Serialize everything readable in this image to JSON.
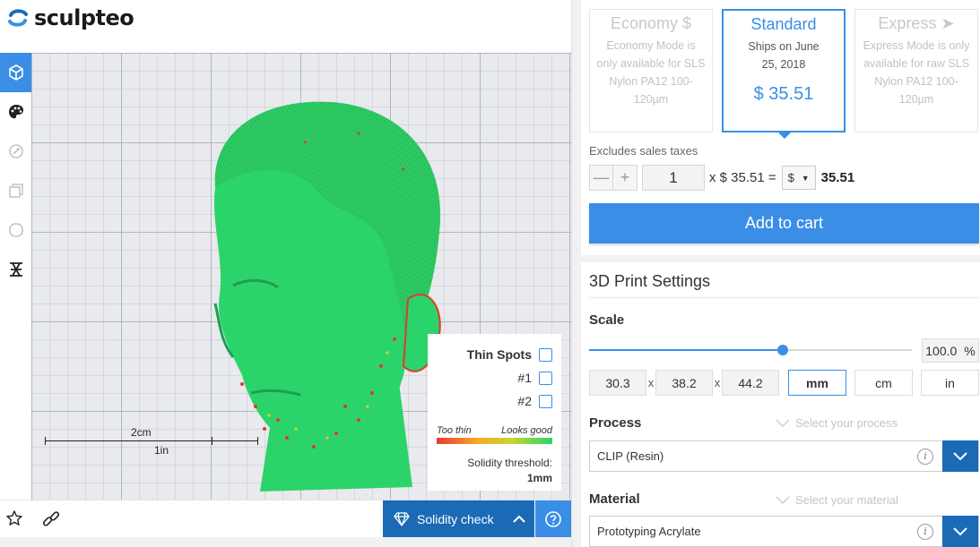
{
  "brand": {
    "name": "sculpteo"
  },
  "toolbar": {
    "items": [
      "cube-view",
      "color-palette",
      "repair",
      "layers",
      "shape",
      "cross-section"
    ]
  },
  "viewer": {
    "ruler": {
      "cm_label": "2cm",
      "in_label": "1in"
    },
    "thin_spots": {
      "title": "Thin Spots",
      "spots": [
        "#1",
        "#2"
      ],
      "legend_low": "Too thin",
      "legend_high": "Looks good",
      "threshold_label": "Solidity threshold:",
      "threshold_value": "1mm"
    }
  },
  "bottombar": {
    "solidity_label": "Solidity check"
  },
  "shipping": {
    "options": [
      {
        "name": "Economy",
        "desc": "Economy Mode is only available for SLS Nylon PA12 100-120µm",
        "selected": false
      },
      {
        "name": "Standard",
        "desc": "Ships on June 25, 2018",
        "price": "$ 35.51",
        "selected": true
      },
      {
        "name": "Express",
        "desc": "Express Mode is only available for raw SLS Nylon PA12 100-120µm",
        "selected": false
      }
    ],
    "taxes_note": "Excludes sales taxes",
    "quantity": "1",
    "unit_price_text": "x $ 35.51 =",
    "currency": "$",
    "total": "35.51",
    "add_to_cart": "Add to cart"
  },
  "print_settings": {
    "title": "3D Print Settings",
    "scale_label": "Scale",
    "scale_percent": "100.0",
    "percent_sign": "%",
    "scale_fraction": 0.6,
    "dims": [
      "30.3",
      "38.2",
      "44.2"
    ],
    "dim_sep": "x",
    "units": [
      "mm",
      "cm",
      "in"
    ],
    "selected_unit": "mm",
    "process_label": "Process",
    "process_hint": "Select your process",
    "process_value": "CLIP (Resin)",
    "material_label": "Material",
    "material_hint": "Select your material",
    "material_value": "Prototyping Acrylate"
  },
  "colors": {
    "accent": "#3a8ee6",
    "dark_accent": "#1b6ab6",
    "model_green": "#2bd46a"
  }
}
